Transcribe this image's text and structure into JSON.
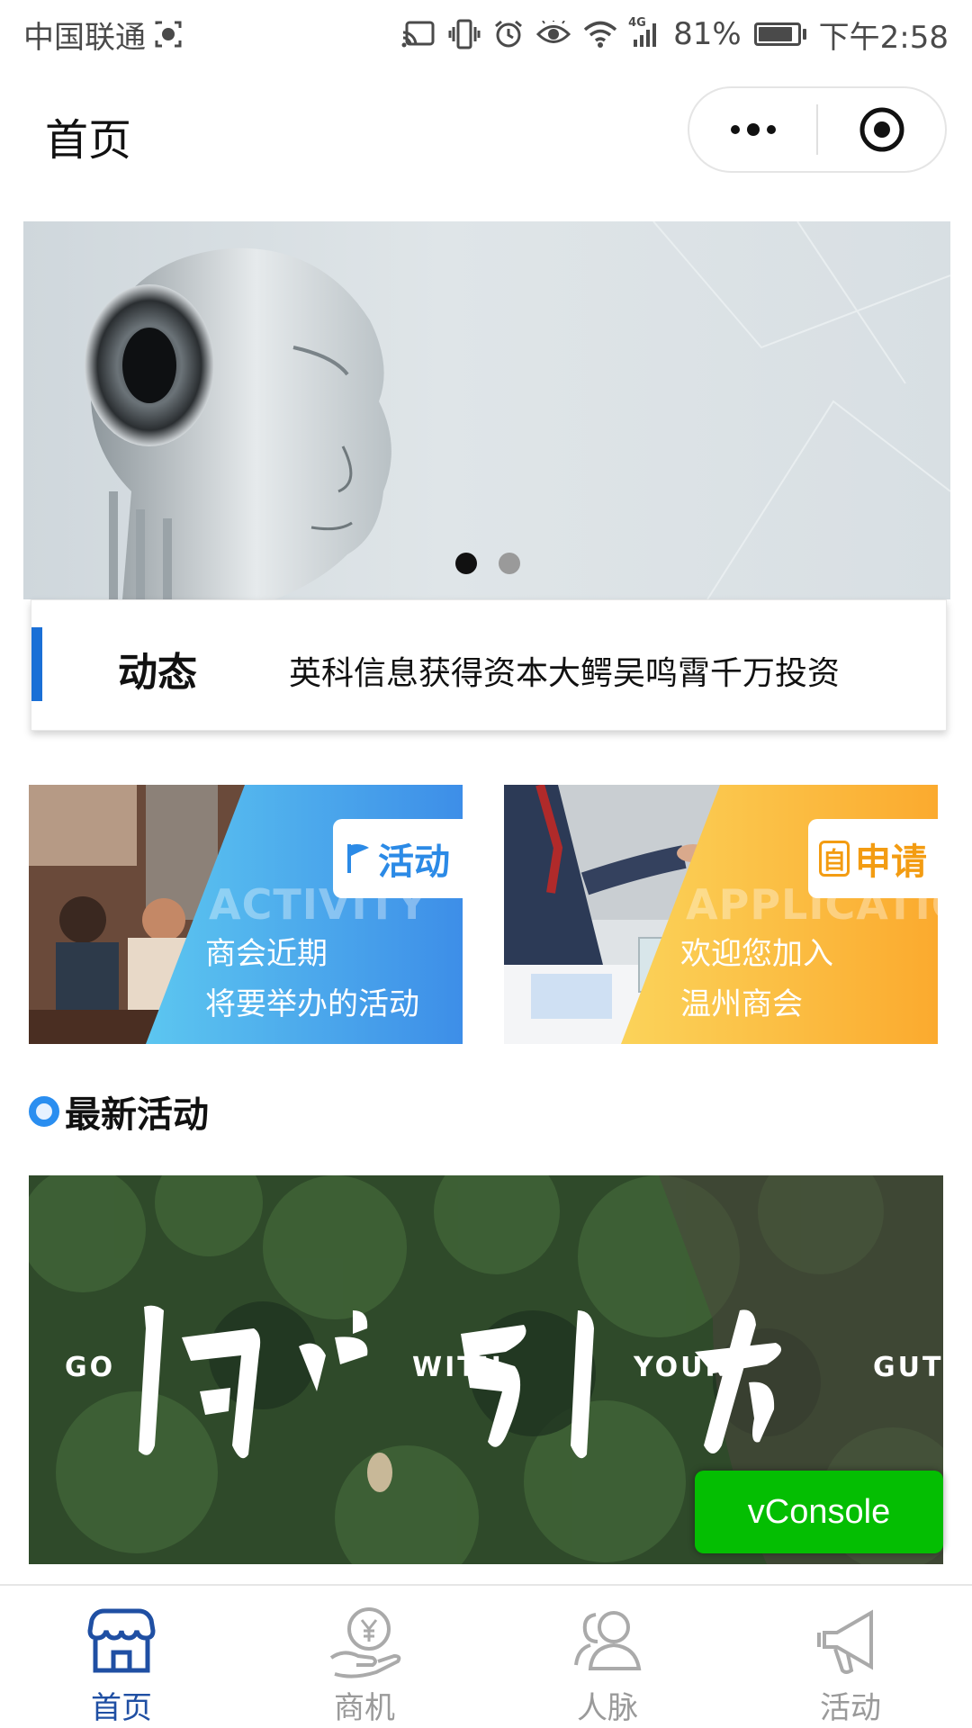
{
  "status_bar": {
    "carrier": "中国联通",
    "battery": "81%",
    "battery_level": 0.81,
    "network": "4G",
    "time": "下午2:58",
    "icons": [
      "screen-record-icon",
      "cast-icon",
      "vibrate-icon",
      "alarm-icon",
      "eye-icon",
      "wifi-icon",
      "signal-icon",
      "battery-icon"
    ]
  },
  "nav": {
    "title": "首页",
    "more_icon": "more-dots-icon",
    "close_icon": "target-close-icon"
  },
  "banner": {
    "slides": 2,
    "active_slide": 1
  },
  "ticker": {
    "label": "动态",
    "text": "英科信息获得资本大鳄吴鸣霄千万投资",
    "accent_color": "#1a6fd6"
  },
  "cards": [
    {
      "tag": "活动",
      "tag_icon": "flag-icon",
      "watermark": "ACTIVITY",
      "line1": "商会近期",
      "line2": "将要举办的活动",
      "color": "#2b8ae6"
    },
    {
      "tag": "申请",
      "tag_icon": "self-badge-icon",
      "tag_badge": "自",
      "watermark": "APPLICATION",
      "line1": "欢迎您加入",
      "line2": "温州商会",
      "color": "#f39c12"
    }
  ],
  "section": {
    "title": "最新活动"
  },
  "featured": {
    "caption_go": "GO",
    "caption_with": "WITH",
    "caption_your": "YOUR",
    "caption_gut": "GUT",
    "calligraphy": "问心引力"
  },
  "vconsole": {
    "label": "vConsole"
  },
  "tabs": [
    {
      "label": "首页",
      "icon": "store-icon",
      "active": true
    },
    {
      "label": "商机",
      "icon": "money-hand-icon",
      "active": false
    },
    {
      "label": "人脉",
      "icon": "people-icon",
      "active": false
    },
    {
      "label": "活动",
      "icon": "megaphone-icon",
      "active": false
    }
  ],
  "colors": {
    "tab_active": "#1f4fa3",
    "tab_inactive": "#9a9a9a",
    "vconsole_green": "#04be02"
  }
}
